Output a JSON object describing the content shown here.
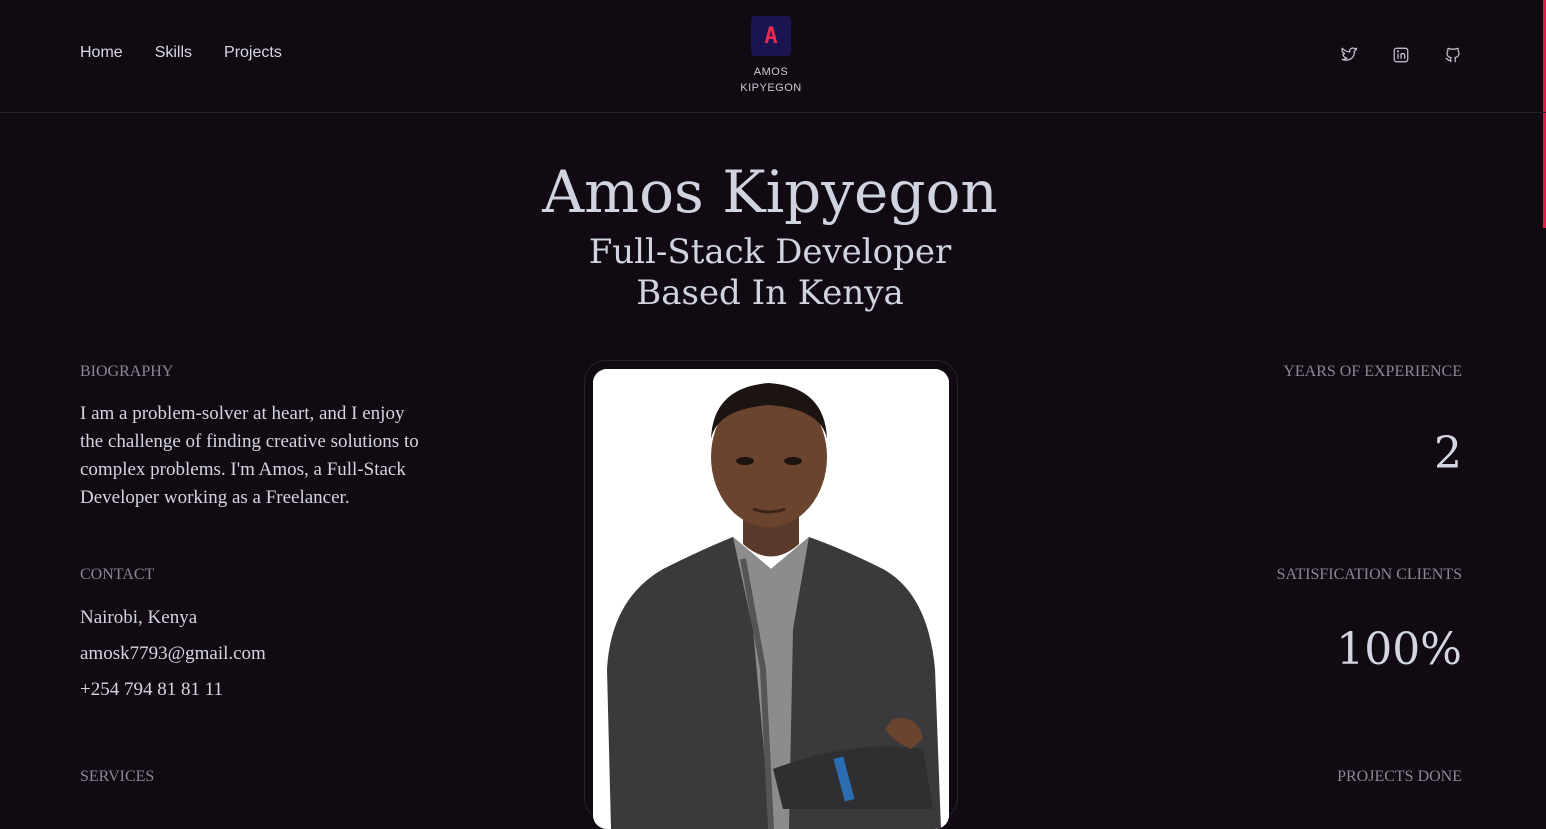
{
  "nav": {
    "links": [
      "Home",
      "Skills",
      "Projects"
    ]
  },
  "brand": {
    "logo_letter": "A",
    "name_line1": "AMOS",
    "name_line2": "KIPYEGON"
  },
  "socials": [
    "twitter-icon",
    "linkedin-icon",
    "github-icon"
  ],
  "hero": {
    "name": "Amos Kipyegon",
    "subtitle_line1": "Full-Stack Developer",
    "subtitle_line2": "Based In Kenya"
  },
  "biography": {
    "label": "BIOGRAPHY",
    "text": "I am a problem-solver at heart, and I enjoy the challenge of finding creative solutions to complex problems. I'm Amos, a Full-Stack Developer working as a Freelancer."
  },
  "contact": {
    "label": "CONTACT",
    "location": "Nairobi, Kenya",
    "email": "amosk7793@gmail.com",
    "phone": "+254 794 81 81 11"
  },
  "services": {
    "label": "SERVICES"
  },
  "stats": {
    "years_label": "YEARS OF EXPERIENCE",
    "years_value": "2",
    "clients_label": "SATISFICATION CLIENTS",
    "clients_value": "100%",
    "projects_label": "PROJECTS DONE"
  },
  "colors": {
    "background": "#120a12",
    "accent": "#e11d48",
    "logo_bg": "#1a1450",
    "text": "#d0d3e0",
    "muted": "#8a8795"
  }
}
